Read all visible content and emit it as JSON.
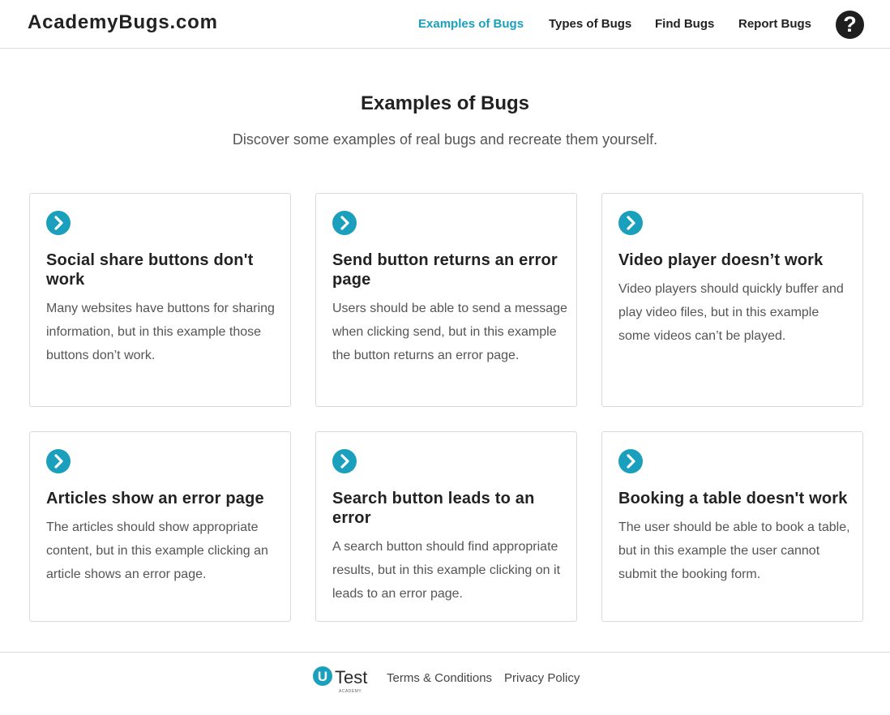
{
  "header": {
    "logo": "AcademyBugs.com",
    "nav": [
      "Examples of Bugs",
      "Types of Bugs",
      "Find Bugs",
      "Report Bugs"
    ],
    "help_icon": "question-mark-icon"
  },
  "main": {
    "title": "Examples of Bugs",
    "subtitle": "Discover some examples of real bugs and recreate them yourself."
  },
  "cards": [
    {
      "title": "Social share buttons don't work",
      "description": "Many websites have buttons for sharing information, but in this example those buttons don’t work."
    },
    {
      "title": "Send button returns an error page",
      "description": "Users should be able to send a message when clicking send, but in this example the button returns an error page."
    },
    {
      "title": "Video player doesn’t work",
      "description": "Video players should quickly buffer and play video files, but in this example some videos can’t be played."
    },
    {
      "title": "Articles show an error page",
      "description": "The articles should show appropriate content, but in this example clicking an article shows an error page."
    },
    {
      "title": "Search button leads to an error",
      "description": "A search button should find appropriate results, but in this example clicking on it leads to an error page."
    },
    {
      "title": "Booking a table doesn't work",
      "description": "The user should be able to book a table, but in this example the user cannot submit the booking form."
    }
  ],
  "footer": {
    "brand_letter": "U",
    "brand_name": "Test",
    "brand_sub": "ACADEMY",
    "links": [
      "Terms & Conditions",
      "Privacy Policy"
    ]
  },
  "colors": {
    "accent": "#1aa0bd",
    "text": "#222222",
    "muted": "#555555",
    "border": "#d9d9d9"
  }
}
